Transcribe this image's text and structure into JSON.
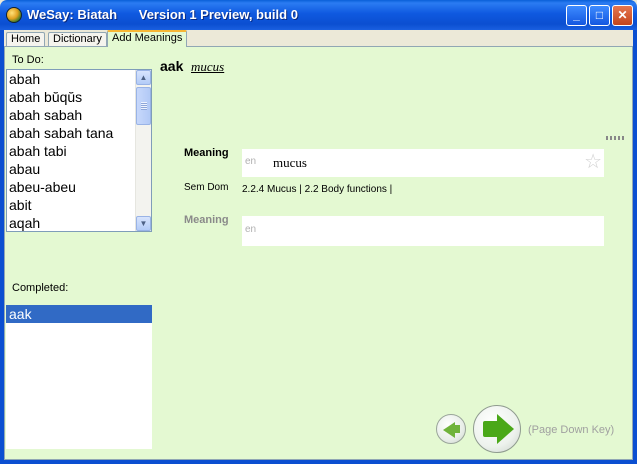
{
  "window": {
    "title": "WeSay: Biatah      Version 1 Preview, build 0",
    "buttons": {
      "minimize": "_",
      "maximize": "□",
      "close": "✕"
    }
  },
  "tabs": [
    {
      "label": "Home"
    },
    {
      "label": "Dictionary"
    },
    {
      "label": "Add Meanings",
      "active": true
    }
  ],
  "todo": {
    "label": "To Do:",
    "items": [
      "abah",
      "abah bŭqŭs",
      "abah sabah",
      "abah sabah tana",
      "abah tabi",
      "abau",
      "abeu-abeu",
      "abit",
      "aqah"
    ],
    "scroll_up": "▲",
    "scroll_down": "▼"
  },
  "completed": {
    "label": "Completed:",
    "items": [
      "aak"
    ]
  },
  "entry": {
    "headword": "aak",
    "gloss_link": "mucus",
    "meaning1": {
      "label": "Meaning",
      "ws": "en",
      "value": "mucus",
      "star": "☆"
    },
    "semdom": {
      "label": "Sem Dom",
      "value": "2.2.4 Mucus | 2.2 Body functions |"
    },
    "meaning2": {
      "label": "Meaning",
      "ws": "en",
      "value": ""
    }
  },
  "navigation": {
    "hint": "(Page Down Key)"
  },
  "colors": {
    "content_bg": "#e4f9d2",
    "selection": "#316ac5",
    "titlebar": "#0b4fd1",
    "arrow_green": "#4aa818"
  }
}
